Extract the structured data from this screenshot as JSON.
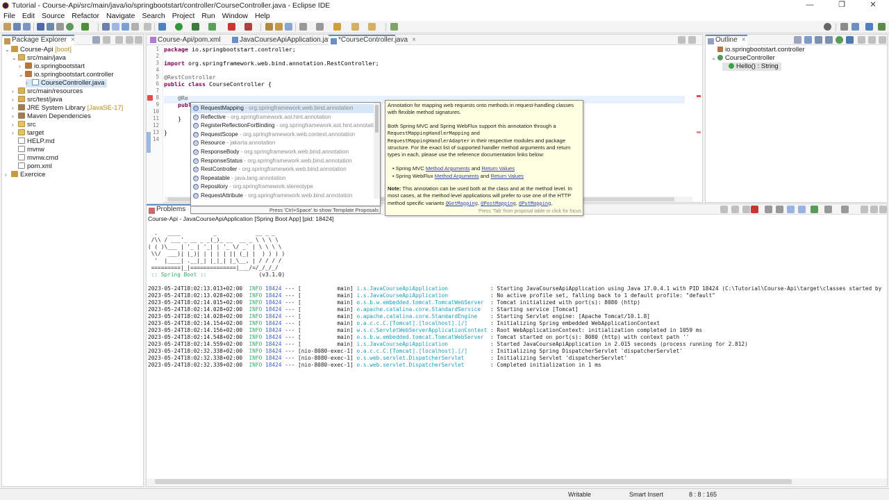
{
  "window": {
    "title": "Tutorial - Course-Api/src/main/java/io/springbootstart/controller/CourseController.java - Eclipse IDE",
    "minimize": "—",
    "maximize": "❐",
    "close": "✕"
  },
  "menu": [
    "File",
    "Edit",
    "Source",
    "Refactor",
    "Navigate",
    "Search",
    "Project",
    "Run",
    "Window",
    "Help"
  ],
  "package_explorer": {
    "tab_label": "Package Explorer",
    "tree": [
      {
        "indent": 0,
        "twisty": "⌄",
        "icon": "proj",
        "label": "Course-Api",
        "decor": "[boot]"
      },
      {
        "indent": 1,
        "twisty": "⌄",
        "icon": "src",
        "label": "src/main/java",
        "decor": ""
      },
      {
        "indent": 2,
        "twisty": "›",
        "icon": "pkg",
        "label": "io.springbootstart",
        "decor": ""
      },
      {
        "indent": 2,
        "twisty": "⌄",
        "icon": "pkg",
        "label": "io.springbootstart.controller",
        "decor": ""
      },
      {
        "indent": 3,
        "twisty": "›",
        "icon": "java",
        "label": "CourseController.java",
        "decor": "",
        "selected": true
      },
      {
        "indent": 1,
        "twisty": "›",
        "icon": "src",
        "label": "src/main/resources",
        "decor": ""
      },
      {
        "indent": 1,
        "twisty": "›",
        "icon": "src",
        "label": "src/test/java",
        "decor": ""
      },
      {
        "indent": 1,
        "twisty": "›",
        "icon": "lib",
        "label": "JRE System Library",
        "decor": "[JavaSE-17]"
      },
      {
        "indent": 1,
        "twisty": "›",
        "icon": "lib",
        "label": "Maven Dependencies",
        "decor": ""
      },
      {
        "indent": 1,
        "twisty": "›",
        "icon": "fold",
        "label": "src",
        "decor": ""
      },
      {
        "indent": 1,
        "twisty": "›",
        "icon": "fold",
        "label": "target",
        "decor": ""
      },
      {
        "indent": 1,
        "twisty": "",
        "icon": "file",
        "label": "HELP.md",
        "decor": ""
      },
      {
        "indent": 1,
        "twisty": "",
        "icon": "file",
        "label": "mvnw",
        "decor": ""
      },
      {
        "indent": 1,
        "twisty": "",
        "icon": "file",
        "label": "mvnw.cmd",
        "decor": ""
      },
      {
        "indent": 1,
        "twisty": "",
        "icon": "file",
        "label": "pom.xml",
        "decor": ""
      },
      {
        "indent": 0,
        "twisty": "›",
        "icon": "proj",
        "label": "Exercice",
        "decor": ""
      }
    ]
  },
  "editor": {
    "tabs": [
      "Course-Api/pom.xml",
      "JavaCourseApiApplication.java",
      "*CourseController.java"
    ],
    "active_tab": 2,
    "lines": [
      {
        "n": "1",
        "parts": [
          [
            "kw",
            "package"
          ],
          [
            "",
            " io.springbootstart.controller;"
          ]
        ]
      },
      {
        "n": "2",
        "parts": []
      },
      {
        "n": "3",
        "parts": [
          [
            "kw",
            "import"
          ],
          [
            "",
            " org.springframework.web.bind.annotation.RestController;"
          ]
        ]
      },
      {
        "n": "4",
        "parts": []
      },
      {
        "n": "5",
        "parts": [
          [
            "ann",
            "@RestController"
          ]
        ]
      },
      {
        "n": "6",
        "parts": [
          [
            "kw",
            "public class"
          ],
          [
            "",
            " CourseController {"
          ]
        ]
      },
      {
        "n": "7",
        "parts": []
      },
      {
        "n": "8",
        "parts": [
          [
            "",
            "    "
          ],
          [
            "ann",
            "@Re"
          ]
        ]
      },
      {
        "n": "9",
        "parts": [
          [
            "",
            "    "
          ],
          [
            "kw",
            "publ"
          ]
        ]
      },
      {
        "n": "10",
        "parts": []
      },
      {
        "n": "11",
        "parts": [
          [
            "",
            "    }"
          ]
        ]
      },
      {
        "n": "12",
        "parts": []
      },
      {
        "n": "13",
        "parts": [
          [
            "",
            "}"
          ]
        ]
      },
      {
        "n": "14",
        "parts": []
      }
    ]
  },
  "proposals": {
    "items": [
      {
        "name": "RequestMapping",
        "pkg": " - org.springframework.web.bind.annotation"
      },
      {
        "name": "Reflective",
        "pkg": " - org.springframework.aot.hint.annotation"
      },
      {
        "name": "RegisterReflectionForBinding",
        "pkg": " - org.springframework.aot.hint.annotation"
      },
      {
        "name": "RequestScope",
        "pkg": " - org.springframework.web.context.annotation"
      },
      {
        "name": "Resource",
        "pkg": " - jakarta.annotation"
      },
      {
        "name": "ResponseBody",
        "pkg": " - org.springframework.web.bind.annotation"
      },
      {
        "name": "ResponseStatus",
        "pkg": " - org.springframework.web.bind.annotation"
      },
      {
        "name": "RestController",
        "pkg": " - org.springframework.web.bind.annotation"
      },
      {
        "name": "Repeatable",
        "pkg": " - java.lang.annotation"
      },
      {
        "name": "Repository",
        "pkg": " - org.springframework.stereotype"
      },
      {
        "name": "RequestAttribute",
        "pkg": " - org.springframework.web.bind.annotation"
      }
    ],
    "selected": 0,
    "footer": "Press 'Ctrl+Space' to show Template Proposals"
  },
  "doc": {
    "p1": "Annotation for mapping web requests onto methods in request-handling classes with flexible method signatures.",
    "p2a": "Both Spring MVC and Spring WebFlux support this annotation through a",
    "p2b": "RequestMappingHandlerMapping",
    "p2c": " and",
    "p2d": "RequestMappingHandlerAdapter",
    "p2e": " in their respective modules and package structure. For the exact list of supported handler method arguments and return types in each, please use the reference documentation links below:",
    "li1_pre": "Spring MVC ",
    "li1_link1": "Method Arguments",
    "li1_mid": " and ",
    "li1_link2": "Return Values",
    "li2_pre": "Spring WebFlux ",
    "li2_link1": "Method Arguments",
    "li2_mid": " and ",
    "li2_link2": "Return Values",
    "note_label": "Note:",
    "note_text": " This annotation can be used both at the class and at the method level. In most cases, at the method level applications will prefer to use one of the HTTP method specific variants ",
    "note_link1": "@GetMapping",
    "note_link2": "@PostMapping",
    "note_link3": "@PutMapping",
    "footer": "Press 'Tab' from proposal table or click for focus"
  },
  "outline": {
    "tab_label": "Outline",
    "items": [
      {
        "indent": 0,
        "label": "io.springbootstart.controller"
      },
      {
        "indent": 0,
        "label": "CourseController"
      },
      {
        "indent": 1,
        "label": "Hello() : String"
      }
    ]
  },
  "problems": {
    "tab_label": "Problems"
  },
  "console": {
    "header": "Course-Api - JavaCourseApiApplication [Spring Boot App] [pid: 18424]",
    "banner": [
      "  .   ____          _            __ _ _",
      " /\\\\ / ___'_ __ _ _(_)_ __  __ _ \\ \\ \\ \\",
      "( ( )\\___ | '_ | '_| | '_ \\/ _` | \\ \\ \\ \\",
      " \\\\/  ___)| |_)| | | | | || (_| |  ) ) ) )",
      "  '  |____| .__|_| |_|_| |_\\__, | / / / /",
      " =========|_|==============|___/=/_/_/_/"
    ],
    "spring_line": " :: Spring Boot ::",
    "version": "(v3.1.0)",
    "logs": [
      {
        "ts": "2023-05-24T18:02:13.013+02:00",
        "thread": "[           main]",
        "logger": "i.s.JavaCourseApiApplication            ",
        "msg": ": Starting JavaCourseApiApplication using Java 17.0.4.1 with PID 18424 (C:\\Tutorial\\Course-Api\\target\\classes started by"
      },
      {
        "ts": "2023-05-24T18:02:13.028+02:00",
        "thread": "[           main]",
        "logger": "i.s.JavaCourseApiApplication            ",
        "msg": ": No active profile set, falling back to 1 default profile: \"default\""
      },
      {
        "ts": "2023-05-24T18:02:14.015+02:00",
        "thread": "[           main]",
        "logger": "o.s.b.w.embedded.tomcat.TomcatWebServer ",
        "msg": ": Tomcat initialized with port(s): 8080 (http)"
      },
      {
        "ts": "2023-05-24T18:02:14.028+02:00",
        "thread": "[           main]",
        "logger": "o.apache.catalina.core.StandardService  ",
        "msg": ": Starting service [Tomcat]"
      },
      {
        "ts": "2023-05-24T18:02:14.028+02:00",
        "thread": "[           main]",
        "logger": "o.apache.catalina.core.StandardEngine   ",
        "msg": ": Starting Servlet engine: [Apache Tomcat/10.1.8]"
      },
      {
        "ts": "2023-05-24T18:02:14.154+02:00",
        "thread": "[           main]",
        "logger": "o.a.c.c.C.[Tomcat].[localhost].[/]      ",
        "msg": ": Initializing Spring embedded WebApplicationContext"
      },
      {
        "ts": "2023-05-24T18:02:14.156+02:00",
        "thread": "[           main]",
        "logger": "w.s.c.ServletWebServerApplicationContext",
        "msg": ": Root WebApplicationContext: initialization completed in 1059 ms"
      },
      {
        "ts": "2023-05-24T18:02:14.548+02:00",
        "thread": "[           main]",
        "logger": "o.s.b.w.embedded.tomcat.TomcatWebServer ",
        "msg": ": Tomcat started on port(s): 8080 (http) with context path ''"
      },
      {
        "ts": "2023-05-24T18:02:14.559+02:00",
        "thread": "[           main]",
        "logger": "i.s.JavaCourseApiApplication            ",
        "msg": ": Started JavaCourseApiApplication in 2.015 seconds (process running for 2.812)"
      },
      {
        "ts": "2023-05-24T18:02:32.338+02:00",
        "thread": "[nio-8080-exec-1]",
        "logger": "o.a.c.c.C.[Tomcat].[localhost].[/]      ",
        "msg": ": Initializing Spring DispatcherServlet 'dispatcherServlet'"
      },
      {
        "ts": "2023-05-24T18:02:32.338+02:00",
        "thread": "[nio-8080-exec-1]",
        "logger": "o.s.web.servlet.DispatcherServlet       ",
        "msg": ": Initializing Servlet 'dispatcherServlet'"
      },
      {
        "ts": "2023-05-24T18:02:32.339+02:00",
        "thread": "[nio-8080-exec-1]",
        "logger": "o.s.web.servlet.DispatcherServlet       ",
        "msg": ": Completed initialization in 1 ms"
      }
    ],
    "level": "INFO",
    "pid": "18424",
    "sep": "---"
  },
  "status": {
    "writable": "Writable",
    "insert_mode": "Smart Insert",
    "position": "8 : 8 : 165"
  },
  "colors": {
    "accent": "#5b8fd0",
    "keyword": "#7f0055",
    "log_level": "#35a86c",
    "logger": "#19a0b8"
  }
}
